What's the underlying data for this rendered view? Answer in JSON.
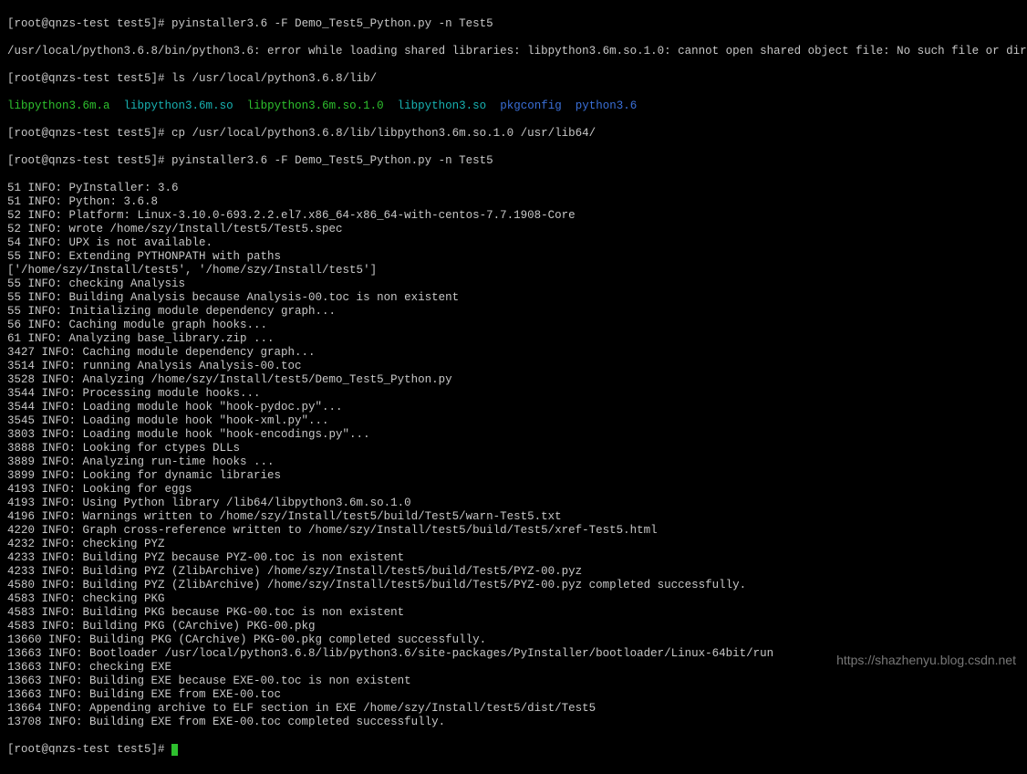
{
  "prompt": "[root@qnzs-test test5]#",
  "cmd1": "pyinstaller3.6 -F Demo_Test5_Python.py -n Test5",
  "err1": "/usr/local/python3.6.8/bin/python3.6: error while loading shared libraries: libpython3.6m.so.1.0: cannot open shared object file: No such file or directory",
  "cmd2": "ls /usr/local/python3.6.8/lib/",
  "ls": {
    "f1": "libpython3.6m.a",
    "f2": "libpython3.6m.so",
    "f3": "libpython3.6m.so.1.0",
    "f4": "libpython3.so",
    "f5": "pkgconfig",
    "f6": "python3.6"
  },
  "cmd3": "cp /usr/local/python3.6.8/lib/libpython3.6m.so.1.0 /usr/lib64/",
  "cmd4": "pyinstaller3.6 -F Demo_Test5_Python.py -n Test5",
  "out": [
    "51 INFO: PyInstaller: 3.6",
    "51 INFO: Python: 3.6.8",
    "52 INFO: Platform: Linux-3.10.0-693.2.2.el7.x86_64-x86_64-with-centos-7.7.1908-Core",
    "52 INFO: wrote /home/szy/Install/test5/Test5.spec",
    "54 INFO: UPX is not available.",
    "55 INFO: Extending PYTHONPATH with paths",
    "['/home/szy/Install/test5', '/home/szy/Install/test5']",
    "55 INFO: checking Analysis",
    "55 INFO: Building Analysis because Analysis-00.toc is non existent",
    "55 INFO: Initializing module dependency graph...",
    "56 INFO: Caching module graph hooks...",
    "61 INFO: Analyzing base_library.zip ...",
    "3427 INFO: Caching module dependency graph...",
    "3514 INFO: running Analysis Analysis-00.toc",
    "3528 INFO: Analyzing /home/szy/Install/test5/Demo_Test5_Python.py",
    "3544 INFO: Processing module hooks...",
    "3544 INFO: Loading module hook \"hook-pydoc.py\"...",
    "3545 INFO: Loading module hook \"hook-xml.py\"...",
    "3803 INFO: Loading module hook \"hook-encodings.py\"...",
    "3888 INFO: Looking for ctypes DLLs",
    "3889 INFO: Analyzing run-time hooks ...",
    "3899 INFO: Looking for dynamic libraries",
    "4193 INFO: Looking for eggs",
    "4193 INFO: Using Python library /lib64/libpython3.6m.so.1.0",
    "4196 INFO: Warnings written to /home/szy/Install/test5/build/Test5/warn-Test5.txt",
    "4220 INFO: Graph cross-reference written to /home/szy/Install/test5/build/Test5/xref-Test5.html",
    "4232 INFO: checking PYZ",
    "4233 INFO: Building PYZ because PYZ-00.toc is non existent",
    "4233 INFO: Building PYZ (ZlibArchive) /home/szy/Install/test5/build/Test5/PYZ-00.pyz",
    "4580 INFO: Building PYZ (ZlibArchive) /home/szy/Install/test5/build/Test5/PYZ-00.pyz completed successfully.",
    "4583 INFO: checking PKG",
    "4583 INFO: Building PKG because PKG-00.toc is non existent",
    "4583 INFO: Building PKG (CArchive) PKG-00.pkg",
    "13660 INFO: Building PKG (CArchive) PKG-00.pkg completed successfully.",
    "13663 INFO: Bootloader /usr/local/python3.6.8/lib/python3.6/site-packages/PyInstaller/bootloader/Linux-64bit/run",
    "13663 INFO: checking EXE",
    "13663 INFO: Building EXE because EXE-00.toc is non existent",
    "13663 INFO: Building EXE from EXE-00.toc",
    "13664 INFO: Appending archive to ELF section in EXE /home/szy/Install/test5/dist/Test5",
    "13708 INFO: Building EXE from EXE-00.toc completed successfully."
  ],
  "watermark": "https://shazhenyu.blog.csdn.net"
}
